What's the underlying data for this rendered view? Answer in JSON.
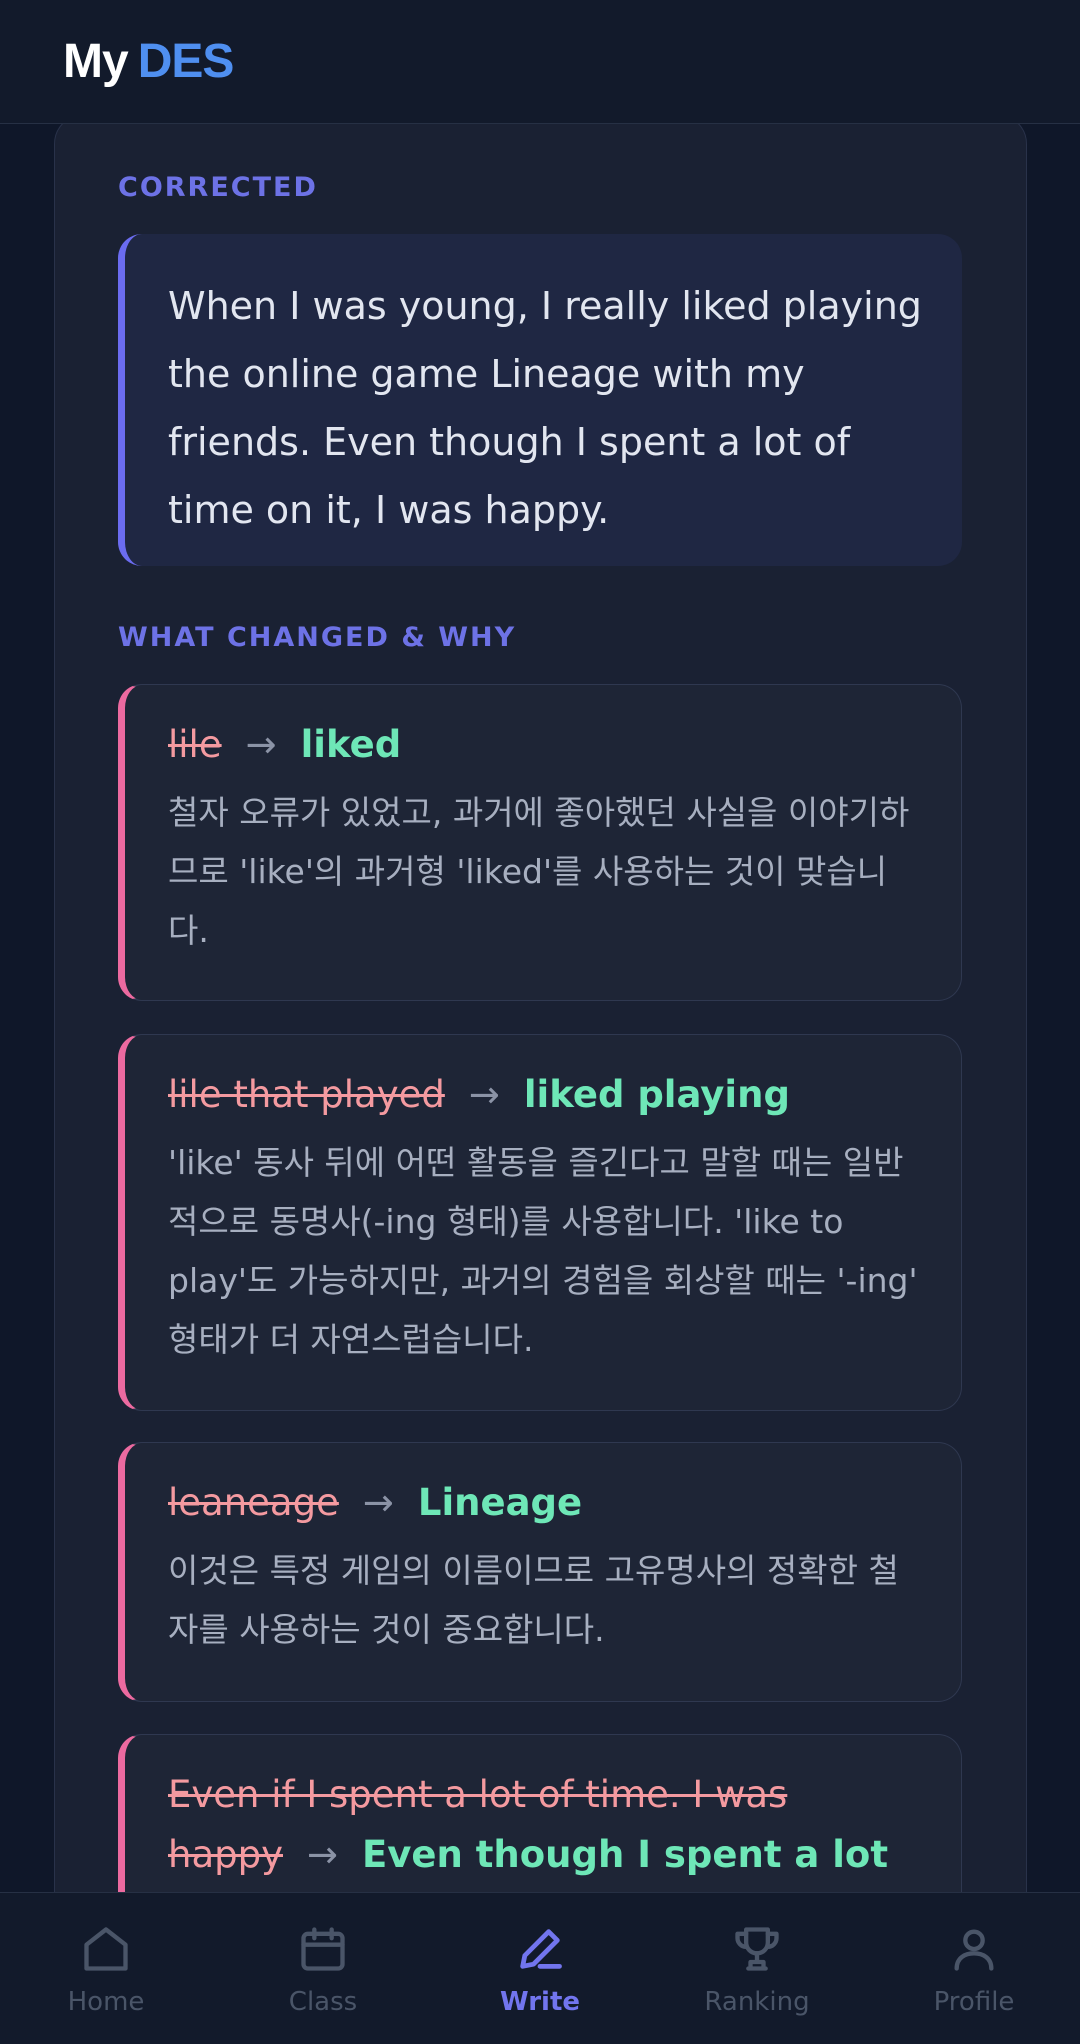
{
  "header": {
    "logo_my": "My",
    "logo_des": "DES"
  },
  "corrected": {
    "label": "CORRECTED",
    "text": "When I was young, I really liked playing the online game Lineage with my friends. Even though I spent a lot of time on it, I was happy."
  },
  "changes": {
    "label": "WHAT CHANGED & WHY",
    "arrow": "→",
    "items": [
      {
        "original": "lile",
        "fixed": "liked",
        "explanation": "철자 오류가 있었고, 과거에 좋아했던 사실을 이야기하므로 'like'의 과거형 'liked'를 사용하는 것이 맞습니다."
      },
      {
        "original": "lile that played",
        "fixed": "liked playing",
        "explanation": "'like' 동사 뒤에 어떤 활동을 즐긴다고 말할 때는 일반적으로 동명사(-ing 형태)를 사용합니다. 'like to play'도 가능하지만, 과거의 경험을 회상할 때는 '-ing' 형태가 더 자연스럽습니다."
      },
      {
        "original": "leaneage",
        "fixed": "Lineage",
        "explanation": "이것은 특정 게임의 이름이므로 고유명사의 정확한 철자를 사용하는 것이 중요합니다."
      },
      {
        "original": "Even if I spent a lot of time. I was happy",
        "fixed": "Even though I spent a lot of time on",
        "explanation": ""
      }
    ]
  },
  "nav": {
    "items": [
      {
        "label": "Home",
        "icon": "home-icon"
      },
      {
        "label": "Class",
        "icon": "calendar-icon"
      },
      {
        "label": "Write",
        "icon": "pencil-icon",
        "active": true
      },
      {
        "label": "Ranking",
        "icon": "trophy-icon"
      },
      {
        "label": "Profile",
        "icon": "user-icon"
      }
    ]
  },
  "colors": {
    "accent": "#6d72e6",
    "original": "#f49aa0",
    "fixed": "#6ee7b7",
    "card_border": "#ec6aa0"
  }
}
